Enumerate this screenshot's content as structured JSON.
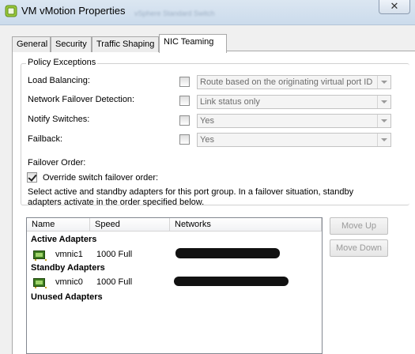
{
  "window": {
    "title": "VM vMotion Properties",
    "background_text": "vSphere Standard Switch",
    "close_glyph": "✕"
  },
  "tabs": [
    {
      "label": "General"
    },
    {
      "label": "Security"
    },
    {
      "label": "Traffic Shaping"
    },
    {
      "label": "NIC Teaming",
      "active": true
    }
  ],
  "policy_exceptions": {
    "legend": "Policy Exceptions",
    "rows": [
      {
        "label": "Load Balancing:",
        "override": false,
        "value": "Route based on the originating virtual port ID"
      },
      {
        "label": "Network Failover Detection:",
        "override": false,
        "value": "Link status only"
      },
      {
        "label": "Notify Switches:",
        "override": false,
        "value": "Yes"
      },
      {
        "label": "Failback:",
        "override": false,
        "value": "Yes"
      }
    ],
    "failover_order_label": "Failover Order:",
    "override_order_label": "Override switch failover order:",
    "override_order_checked": true,
    "help_line1": "Select active and standby adapters for this port group.  In a failover situation, standby",
    "help_line2": "adapters activate  in the order specified below."
  },
  "adapters": {
    "columns": [
      "Name",
      "Speed",
      "Networks"
    ],
    "active_header": "Active Adapters",
    "standby_header": "Standby Adapters",
    "unused_header": "Unused Adapters",
    "active": [
      {
        "name": "vmnic1",
        "speed": "1000 Full",
        "icon": "nic-icon"
      }
    ],
    "standby": [
      {
        "name": "vmnic0",
        "speed": "1000 Full",
        "icon": "nic-icon"
      }
    ]
  },
  "buttons": {
    "move_up": "Move Up",
    "move_down": "Move Down"
  },
  "colors": {
    "titlebar": "#cbdbec",
    "panel": "#ffffff",
    "nic_green": "#3c7a1f",
    "disabled_text": "#6d6d6d"
  }
}
